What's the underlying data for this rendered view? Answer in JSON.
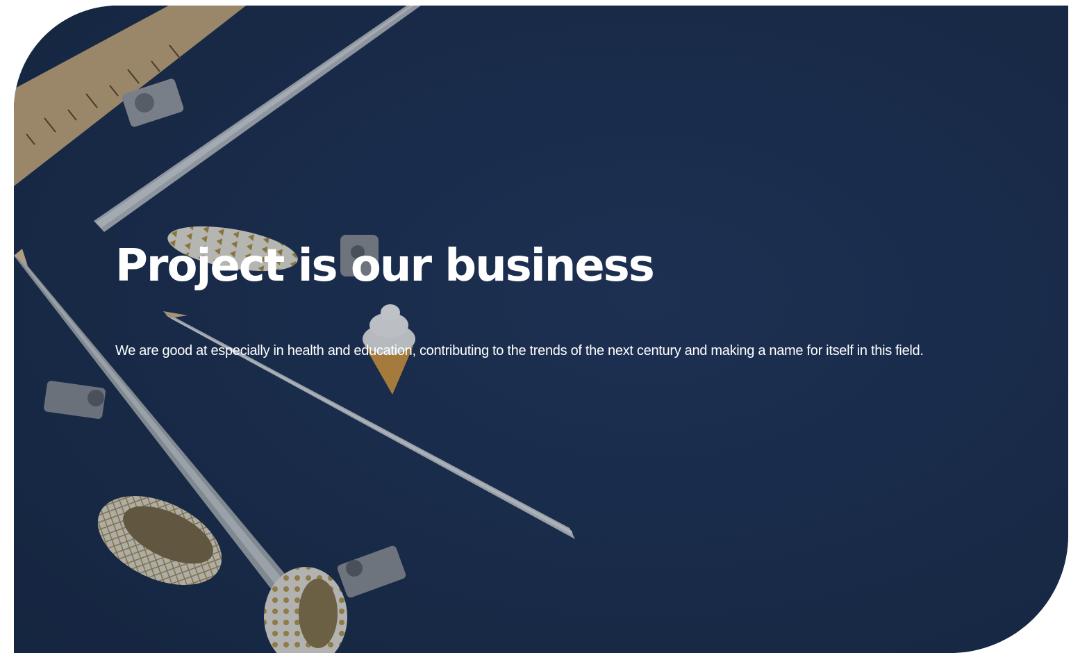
{
  "hero": {
    "title": "Project is our business",
    "subtitle": "We are good at especially in health and education, contributing to the trends of the next century and making a name for itself in this field.",
    "background_color": "#1b2d4b",
    "image_objects": [
      "ruler",
      "pencil",
      "pencil",
      "pencil",
      "binder-clip",
      "binder-clip",
      "binder-clip",
      "binder-clip",
      "washi-tape",
      "washi-tape",
      "washi-tape",
      "ice-cream-eraser"
    ]
  }
}
